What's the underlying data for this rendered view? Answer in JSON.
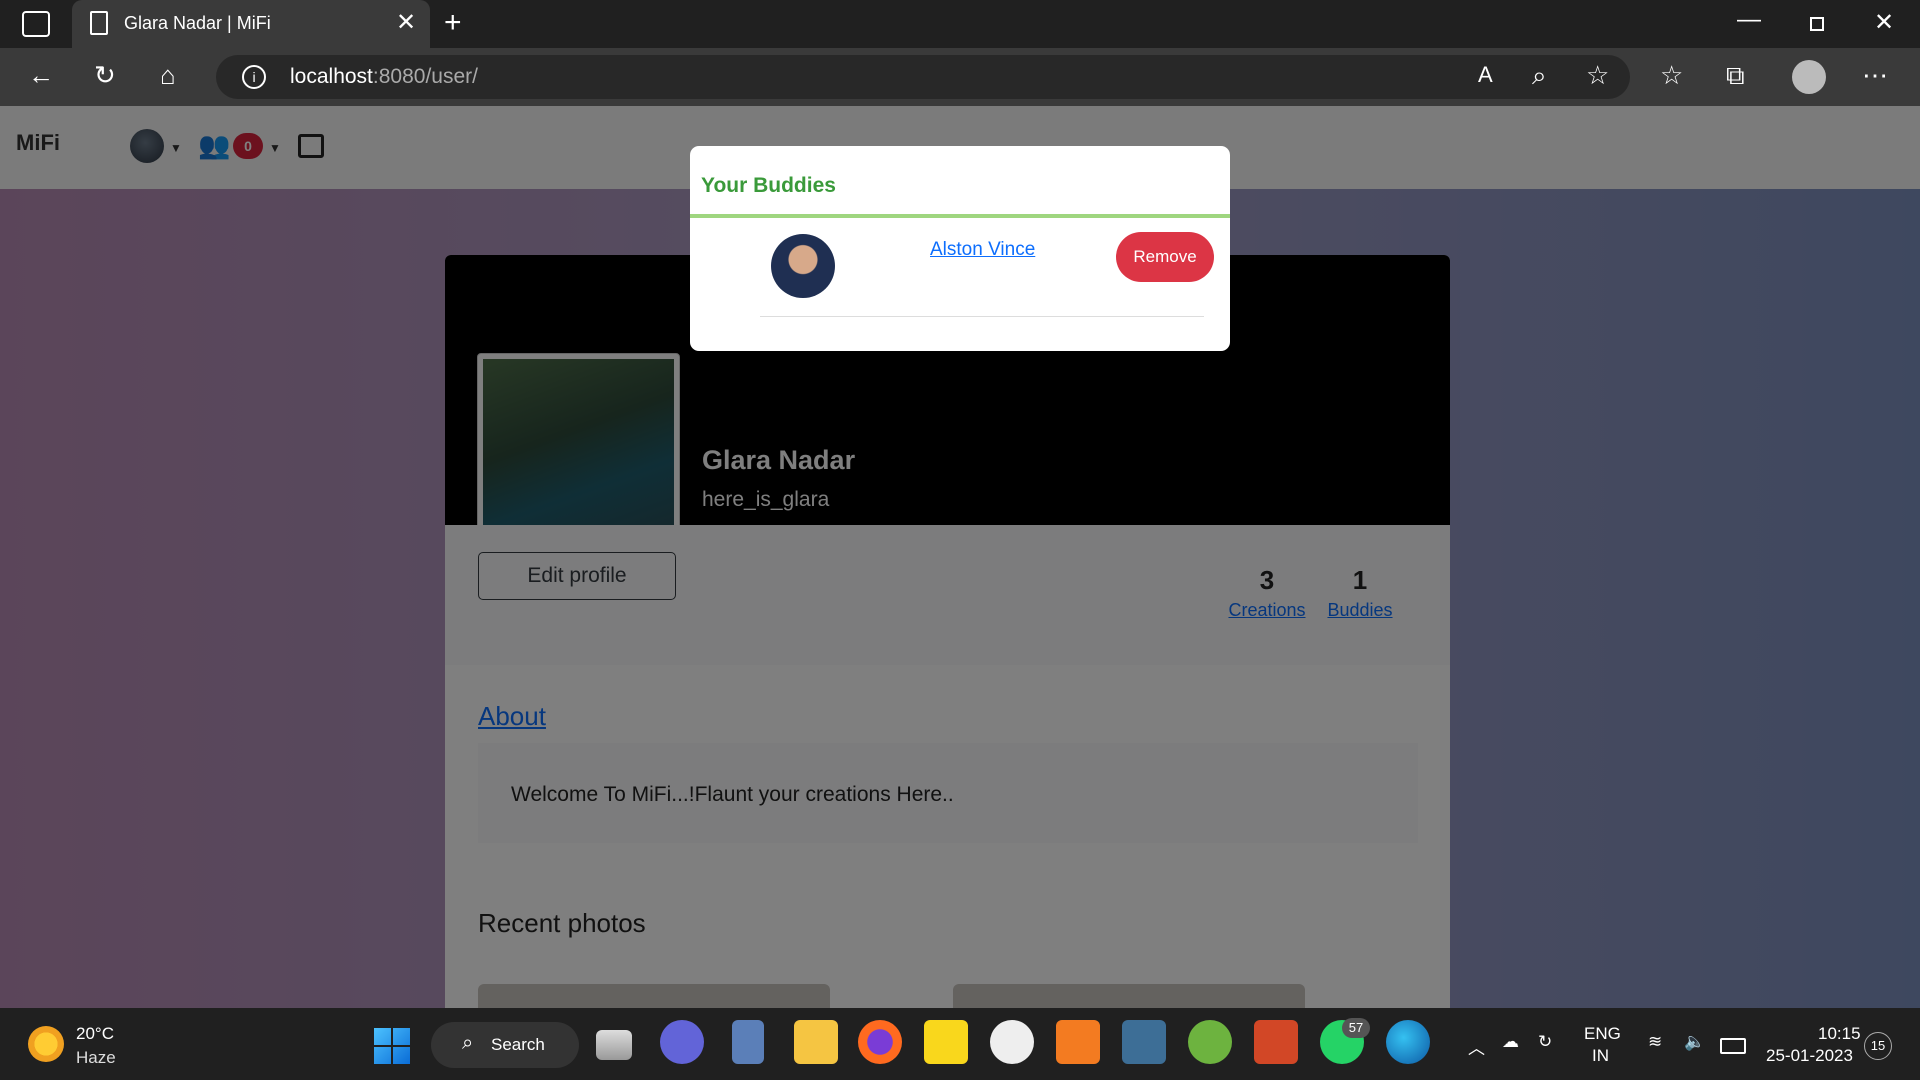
{
  "browser": {
    "tab_title": "Glara Nadar | MiFi",
    "url_host": "localhost",
    "url_rest": ":8080/user/"
  },
  "navbar": {
    "brand": "MiFi",
    "notification_count": "0"
  },
  "profile": {
    "name": "Glara Nadar",
    "username": "here_is_glara",
    "edit_label": "Edit profile",
    "creations_count": "3",
    "creations_label": "Creations",
    "buddies_count": "1",
    "buddies_label": "Buddies",
    "about_label": "About",
    "about_text": "Welcome To MiFi...!Flaunt your creations Here..",
    "recent_label": "Recent photos"
  },
  "modal": {
    "title": "Your Buddies",
    "buddies": [
      {
        "name": "Alston Vince",
        "action": "Remove"
      }
    ]
  },
  "taskbar": {
    "weather_temp": "20°C",
    "weather_desc": "Haze",
    "search_label": "Search",
    "whatsapp_badge": "57",
    "lang_line1": "ENG",
    "lang_line2": "IN",
    "time": "10:15",
    "date": "25-01-2023",
    "notif_count": "15"
  },
  "colors": {
    "accent_green": "#3a9a3a",
    "remove_red": "#dc3545",
    "link_blue": "#0d6efd"
  }
}
